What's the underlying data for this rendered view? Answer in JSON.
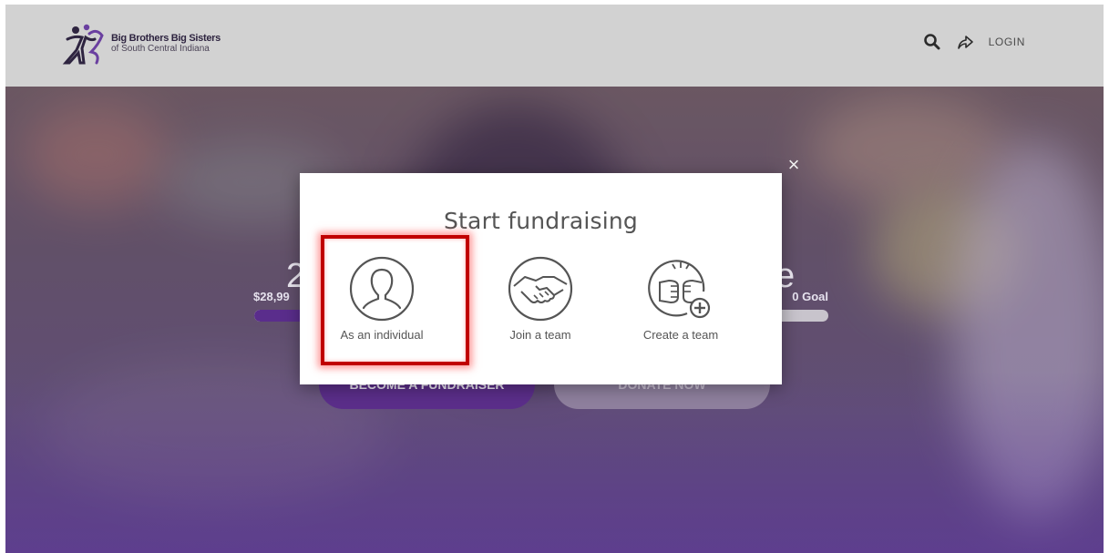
{
  "header": {
    "org_name_line1": "Big Brothers Big Sisters",
    "org_name_line2": "of South Central Indiana",
    "login_label": "LOGIN",
    "icons": [
      "search-icon",
      "share-icon"
    ]
  },
  "hero": {
    "title_partial_left": "2",
    "title_partial_right": "e",
    "raised_partial": "$28,99",
    "goal_partial": "0 Goal",
    "progress_fraction": 0.2,
    "become_fundraiser_label": "BECOME A FUNDRAISER",
    "donate_label": "DONATE NOW"
  },
  "modal": {
    "title": "Start fundraising",
    "close_label": "×",
    "options": [
      {
        "label": "As an individual",
        "icon": "person-icon"
      },
      {
        "label": "Join a team",
        "icon": "handshake-icon"
      },
      {
        "label": "Create a team",
        "icon": "fist-bump-plus-icon"
      }
    ]
  },
  "colors": {
    "brand_purple": "#5b2e8a",
    "highlight_red": "#c00000"
  }
}
